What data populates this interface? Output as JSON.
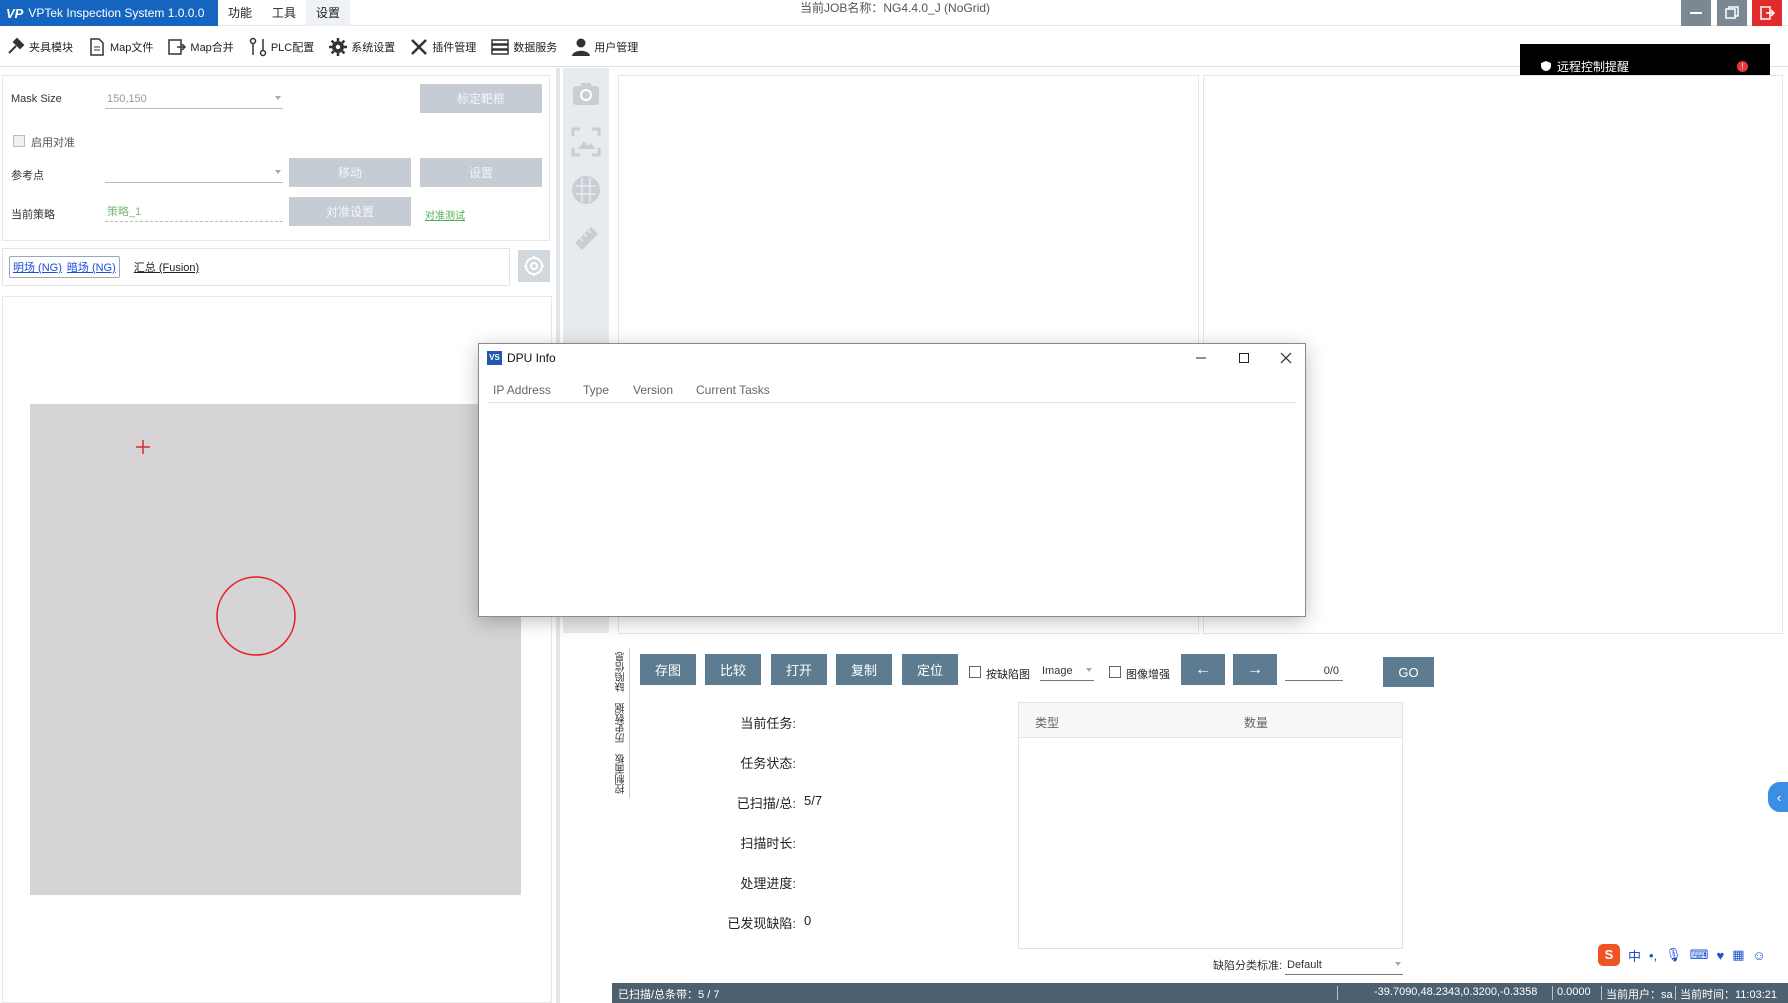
{
  "app": {
    "title": "VPTek Inspection System 1.0.0.0",
    "logo_text": "VP",
    "menu": [
      "功能",
      "工具",
      "设置"
    ],
    "job_name": "当前JOB名称：NG4.4.0_J (NoGrid)",
    "colors": {
      "accent": "#1565c0",
      "button": "#5d7c91",
      "status_bar": "#4c6070",
      "close": "#e22b2b"
    }
  },
  "toolbar": {
    "items": [
      {
        "label": "夹具模块",
        "icon": "fixture-icon"
      },
      {
        "label": "Map文件",
        "icon": "file-icon"
      },
      {
        "label": "Map合并",
        "icon": "merge-icon"
      },
      {
        "label": "PLC配置",
        "icon": "plc-icon"
      },
      {
        "label": "系统设置",
        "icon": "gear-icon"
      },
      {
        "label": "插件管理",
        "icon": "tools-icon"
      },
      {
        "label": "数据服务",
        "icon": "database-icon"
      },
      {
        "label": "用户管理",
        "icon": "user-icon"
      }
    ]
  },
  "toast": {
    "text": "远程控制提醒",
    "badge": "!"
  },
  "left": {
    "mask_size_label": "Mask Size",
    "mask_size_value": "150,150",
    "calibrate_button": "标定靶框",
    "enable_align_label": "启用对准",
    "ref_point_label": "参考点",
    "ref_point_value": "",
    "move_button": "移动",
    "set_button": "设置",
    "strategy_label": "当前策略",
    "strategy_value": "策略_1",
    "align_settings_button": "对准设置",
    "align_test_link": "对准测试",
    "tabs": [
      "明场 (NG)",
      "暗场 (NG)"
    ],
    "fusion_tab": "汇总 (Fusion)"
  },
  "controls": {
    "vertical_tabs": [
      "缺陷信息",
      "历史数据",
      "控制面板"
    ],
    "buttons": [
      "存图",
      "比较",
      "打开",
      "复制",
      "定位"
    ],
    "defect_map_label": "按缺陷图",
    "image_select": "Image",
    "enhance_label": "图像增强",
    "prev_arrow": "←",
    "next_arrow": "→",
    "page_count": "0/0",
    "go_button": "GO"
  },
  "stats": [
    {
      "label": "当前任务:",
      "value": ""
    },
    {
      "label": "任务状态:",
      "value": ""
    },
    {
      "label": "已扫描/总:",
      "value": "5/7"
    },
    {
      "label": "扫描时长:",
      "value": ""
    },
    {
      "label": "处理进度:",
      "value": ""
    },
    {
      "label": "已发现缺陷:",
      "value": "0"
    }
  ],
  "defect_table": {
    "columns": [
      "类型",
      "数量"
    ]
  },
  "defect_standard": {
    "label": "缺陷分类标准:",
    "value": "Default"
  },
  "status_bar": {
    "scan": "已扫描/总条带：5 / 7",
    "coords": "-39.7090,48.2343,0.3200,-0.3358",
    "value": "0.0000",
    "user": "当前用户：sa",
    "time": "当前时间：11:03:21"
  },
  "ime": {
    "lang": "中"
  },
  "dialog": {
    "icon_text": "VS",
    "title": "DPU Info",
    "columns": [
      "IP Address",
      "Type",
      "Version",
      "Current Tasks"
    ]
  }
}
